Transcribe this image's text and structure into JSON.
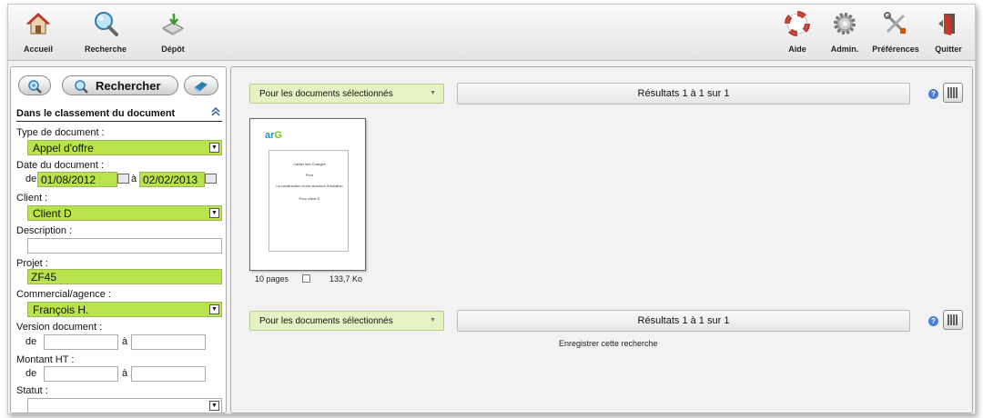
{
  "toolbar": {
    "left_items": [
      {
        "label": "Accueil",
        "icon": "home-icon"
      },
      {
        "label": "Recherche",
        "icon": "magnifier-icon"
      },
      {
        "label": "Dépôt",
        "icon": "upload-tray-icon"
      }
    ],
    "right_items": [
      {
        "label": "Aide",
        "icon": "lifebuoy-icon"
      },
      {
        "label": "Admin.",
        "icon": "gear-icon"
      },
      {
        "label": "Préférences",
        "icon": "tools-icon"
      },
      {
        "label": "Quitter",
        "icon": "exit-door-icon"
      }
    ]
  },
  "search_panel": {
    "search_button_label": "Rechercher",
    "section_title": "Dans le classement du document",
    "fields": {
      "type_label": "Type de document :",
      "type_value": "Appel d'offre",
      "date_label": "Date du document :",
      "date_from_prefix": "de",
      "date_from": "01/08/2012",
      "date_to_prefix": "à",
      "date_to": "02/02/2013",
      "client_label": "Client :",
      "client_value": "Client D",
      "description_label": "Description :",
      "description_value": "",
      "projet_label": "Projet :",
      "projet_value": "ZF45",
      "commercial_label": "Commercial/agence :",
      "commercial_value": "François H.",
      "version_label": "Version document :",
      "version_from_prefix": "de",
      "version_to_prefix": "à",
      "montant_label": "Montant HT :",
      "montant_from_prefix": "de",
      "montant_to_prefix": "à",
      "statut_label": "Statut :",
      "statut_value": ""
    }
  },
  "results": {
    "action_select_label": "Pour les documents sélectionnés",
    "results_text": "Résultats 1 à 1 sur 1",
    "document": {
      "pages": "10 pages",
      "size": "133,7 Ko",
      "logo_text_a": "ar",
      "logo_text_b": "G",
      "page_lines": [
        "Cahier des Charges",
        "Pour",
        "La construction d'une structure d'isolation",
        "Pour client D"
      ]
    },
    "save_search_label": "Enregistrer cette recherche"
  },
  "colors": {
    "field_green": "#b8e34a",
    "action_green": "#e4f2c4",
    "help_blue": "#4a7fd0"
  }
}
